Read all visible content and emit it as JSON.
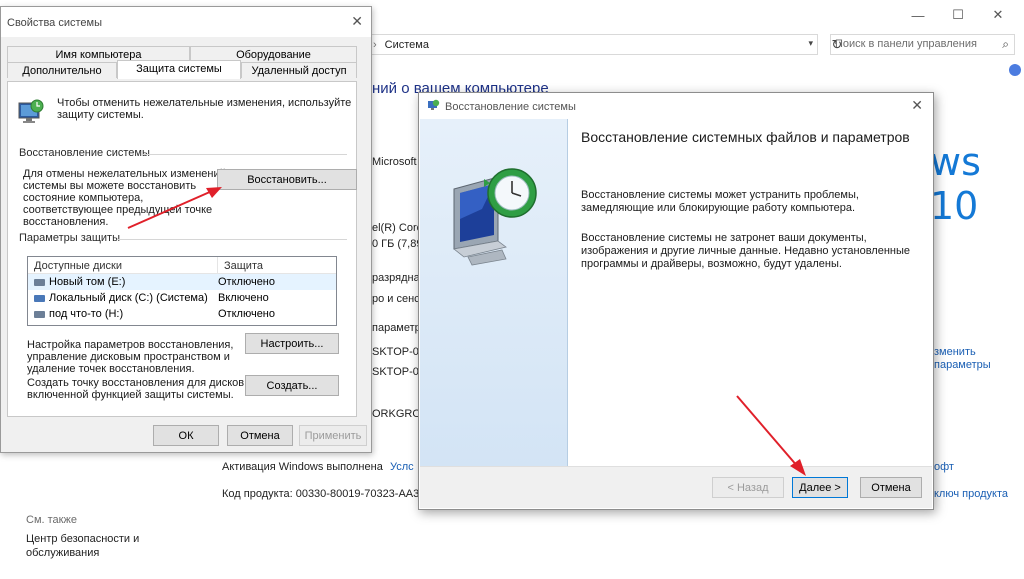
{
  "background": {
    "address": {
      "separator": "›",
      "location": "Система"
    },
    "search": {
      "placeholder": "Поиск в панели управления"
    },
    "heading": "ний о вашем компьютере",
    "os_edition_partial": "Microsoft",
    "windows_logo": "ws 10",
    "processor_partial": "el(R) Core",
    "ram_partial": "0 ГБ (7,89",
    "system_type_partial": "разрядна",
    "pen_partial": "ро и сенс",
    "computer_params_partial": "параметр",
    "computer_name_partial": "SKTOP-0F",
    "full_name_partial": "SKTOP-0F",
    "workgroup_partial": "ORKGROU",
    "change_link_1": "зменить",
    "change_link_2": "параметры",
    "activation_label": "Активация Windows выполнена",
    "activation_link_partial": "Услс",
    "ms_link_partial": "офт",
    "product_key_label": "Код продукта: 00330-80019-70323-AA37",
    "product_key_link_partial": "ключ продукта",
    "see_also": "См. также",
    "security_center_1": "Центр безопасности и",
    "security_center_2": "обслуживания"
  },
  "sysprops": {
    "title": "Свойства системы",
    "tabs_row1": [
      "Имя компьютера",
      "Оборудование"
    ],
    "tabs_row2": [
      "Дополнительно",
      "Защита системы",
      "Удаленный доступ"
    ],
    "intro_1": "Чтобы отменить нежелательные изменения, используйте",
    "intro_2": "защиту системы.",
    "restore_group": "Восстановление системы",
    "restore_desc_1": "Для отмены нежелательных изменений",
    "restore_desc_2": "системы вы можете восстановить",
    "restore_desc_3": "состояние компьютера,",
    "restore_desc_4": "соответствующее предыдущей точке",
    "restore_desc_5": "восстановления.",
    "restore_button": "Восстановить...",
    "protection_group": "Параметры защиты",
    "disks_header": [
      "Доступные диски",
      "Защита"
    ],
    "disks": [
      {
        "name": "Новый том (E:)",
        "status": "Отключено"
      },
      {
        "name": "Локальный диск (C:) (Система)",
        "status": "Включено"
      },
      {
        "name": "под что-то (H:)",
        "status": "Отключено"
      }
    ],
    "configure_desc_1": "Настройка параметров восстановления,",
    "configure_desc_2": "управление дисковым пространством и",
    "configure_desc_3": "удаление точек восстановления.",
    "configure_button": "Настроить...",
    "create_desc_1": "Создать точку восстановления для дисков с",
    "create_desc_2": "включенной функцией защиты системы.",
    "create_button": "Создать...",
    "ok_button": "ОК",
    "cancel_button": "Отмена",
    "apply_button": "Применить"
  },
  "wizard": {
    "title": "Восстановление системы",
    "heading": "Восстановление системных файлов и параметров",
    "p1_1": "Восстановление системы может устранить проблемы,",
    "p1_2": "замедляющие или блокирующие работу компьютера.",
    "p2_1": "Восстановление системы не затронет ваши документы,",
    "p2_2": "изображения и другие личные данные. Недавно установленные",
    "p2_3": "программы и драйверы, возможно, будут удалены.",
    "back_button": "< Назад",
    "next_button": "Далее >",
    "cancel_button": "Отмена"
  },
  "colors": {
    "annotation_arrow": "#e0202a",
    "link": "#1a5fb4",
    "accent": "#0078d7"
  }
}
